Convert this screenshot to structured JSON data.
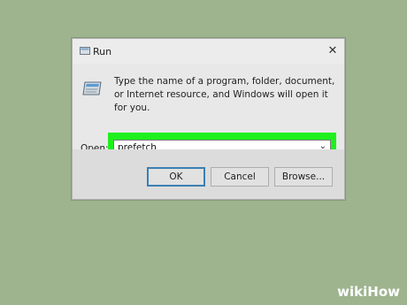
{
  "dialog": {
    "title": "Run",
    "close_symbol": "✕",
    "description": "Type the name of a program, folder, document, or Internet resource, and Windows will open it for you.",
    "open_label_underlined": "O",
    "open_label_rest": "pen:",
    "input_value": "prefetch",
    "dropdown_symbol": "⌄",
    "buttons": {
      "ok": "OK",
      "cancel": "Cancel",
      "browse": "Browse..."
    },
    "highlight_color": "#1ef01e"
  },
  "watermark": {
    "wiki": "wiki",
    "how": "How"
  },
  "icons": {
    "title_icon": "run-app-icon",
    "run_icon": "run-program-icon"
  },
  "colors": {
    "background": "#9db48f",
    "dialog": "#e8e8e8",
    "footer": "#dcdcdc"
  }
}
